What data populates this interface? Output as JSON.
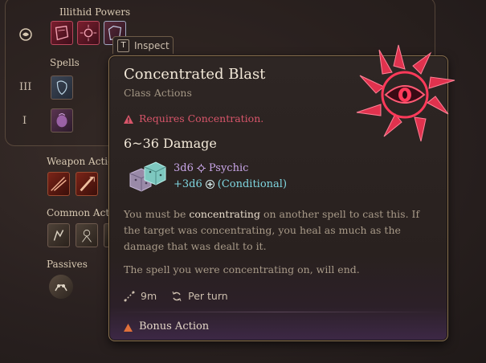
{
  "sections": {
    "illithid": "Illithid Powers",
    "spells": "Spells",
    "weapon": "Weapon Actio",
    "common": "Common Acti",
    "passives": "Passives"
  },
  "rows": {
    "level3": "III",
    "level1": "I"
  },
  "inspect": {
    "key": "T",
    "label": "Inspect"
  },
  "tooltip": {
    "title": "Concentrated Blast",
    "subtitle": "Class Actions",
    "requirement": "Requires Concentration.",
    "damage": "6~36 Damage",
    "dice1": "3d6",
    "type1": "Psychic",
    "dice2": "+3d6",
    "type2": "(Conditional)",
    "desc_a": "You must be ",
    "desc_b": "concentrating",
    "desc_c": " on another spell to cast this. If the target was concentrating, you heal as much as the damage that was dealt to it.",
    "desc2": "The spell you were concentrating on, will end.",
    "range": "9m",
    "recharge": "Per turn",
    "action": "Bonus Action"
  },
  "colors": {
    "psychic": "#c9a6e8",
    "conditional": "#7fd6e0",
    "warning": "#d8556a",
    "bonus": "#e0703a"
  }
}
